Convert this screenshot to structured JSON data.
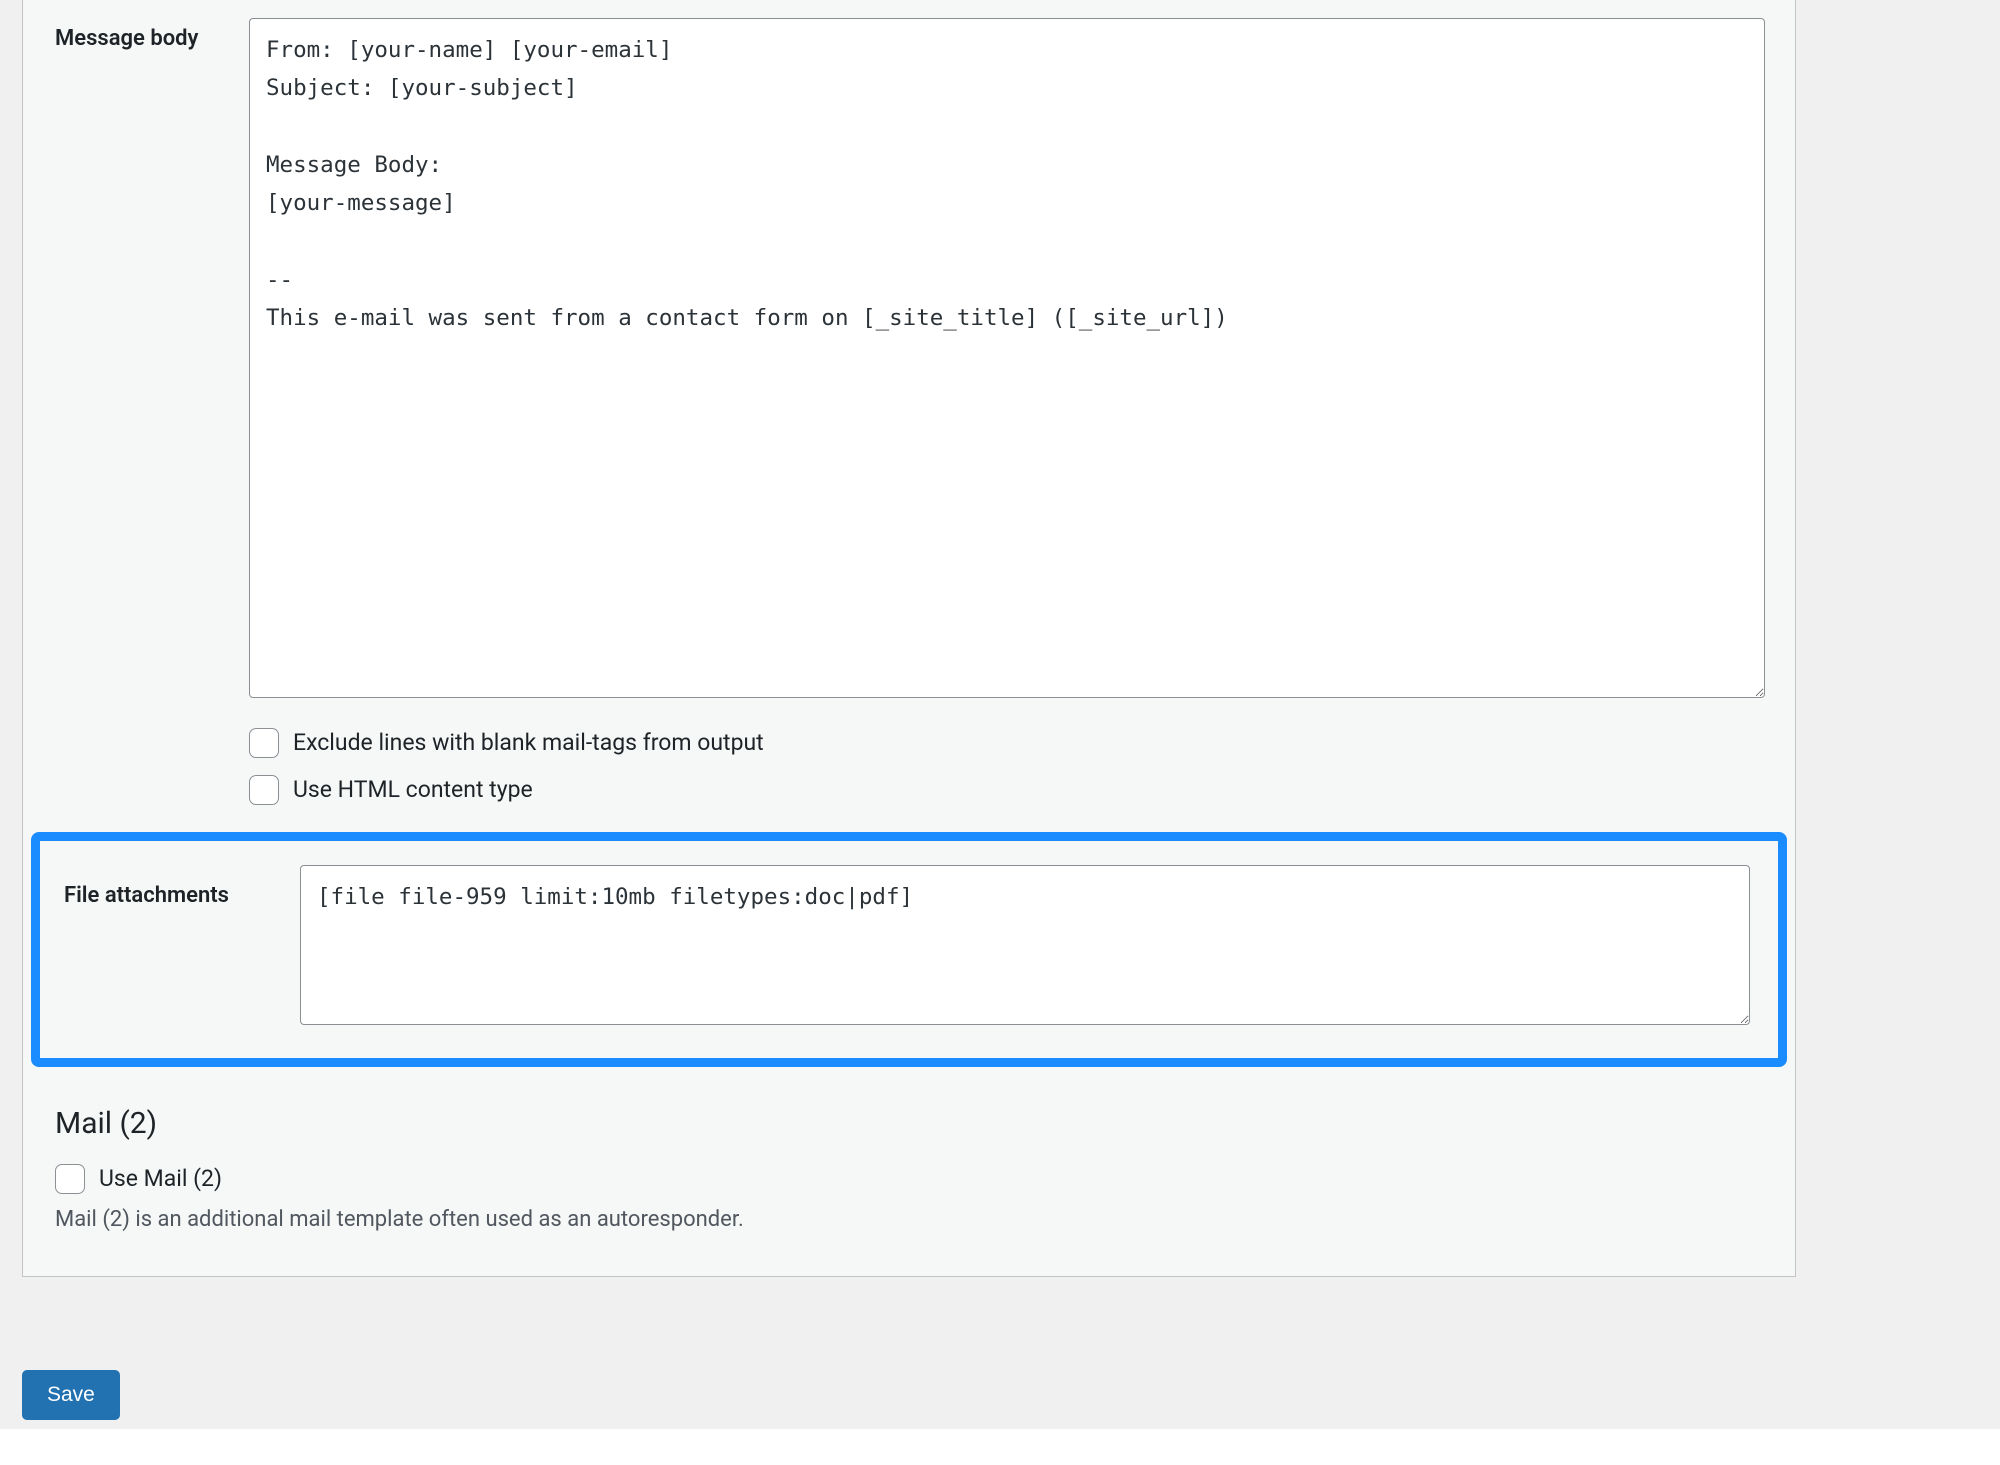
{
  "form": {
    "message_body": {
      "label": "Message body",
      "value": "From: [your-name] [your-email]\nSubject: [your-subject]\n\nMessage Body:\n[your-message]\n\n-- \nThis e-mail was sent from a contact form on [_site_title] ([_site_url])"
    },
    "options": {
      "exclude_blank_label": "Exclude lines with blank mail-tags from output",
      "use_html_label": "Use HTML content type"
    },
    "file_attachments": {
      "label": "File attachments",
      "value": "[file file-959 limit:10mb filetypes:doc|pdf]"
    },
    "mail2": {
      "heading": "Mail (2)",
      "use_label": "Use Mail (2)",
      "description": "Mail (2) is an additional mail template often used as an autoresponder."
    }
  },
  "buttons": {
    "save": "Save"
  }
}
